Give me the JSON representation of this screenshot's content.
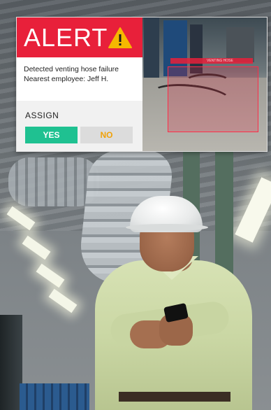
{
  "alert": {
    "title": "ALERT",
    "warning_icon": "warning-triangle-icon",
    "message_line1": "Detected venting hose failure",
    "message_line2": "Nearest employee: Jeff H.",
    "assign_label": "ASSIGN",
    "yes_label": "YES",
    "no_label": "NO",
    "detection_tag": "VENTING HOSE",
    "colors": {
      "header": "#e8203a",
      "yes_button": "#1fc191",
      "no_button_text": "#f0a20a",
      "detection_box": "#ff2b47"
    }
  }
}
